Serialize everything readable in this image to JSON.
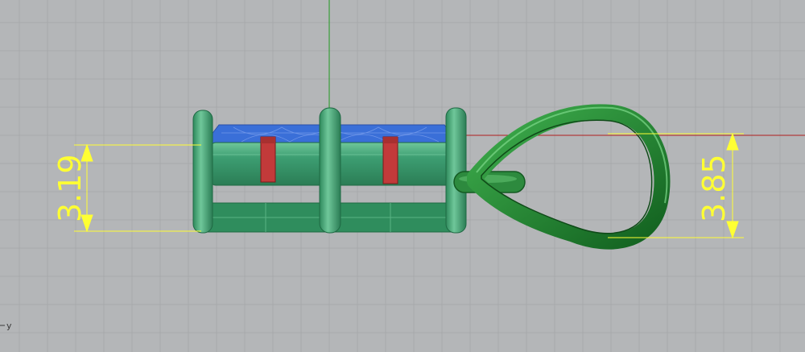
{
  "viewport": {
    "axis_label_y": "y",
    "colors": {
      "background": "#b4b6b8",
      "grid_minor": "#a7a9ab",
      "grid_major": "#9c9ea0",
      "axis_x": "#b01e1e",
      "axis_y": "#1f9a1f",
      "dimension": "#ffff33",
      "body_green": "#3a9a6c",
      "ring_green": "#1f7a2a",
      "top_blue": "#3a6fd8",
      "marker_red": "#c23a3a"
    }
  },
  "dimensions": [
    {
      "id": "left",
      "value": "3.19"
    },
    {
      "id": "right",
      "value": "3.85"
    }
  ]
}
